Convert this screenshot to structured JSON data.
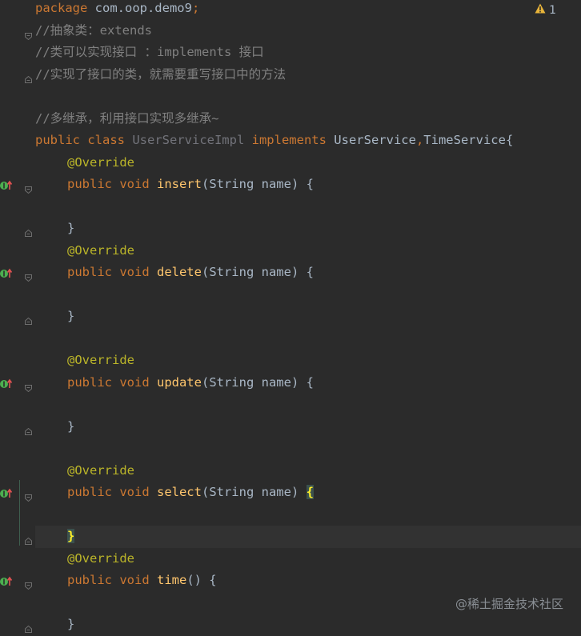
{
  "editor": {
    "lines": [
      [
        {
          "t": "kw",
          "v": "package "
        },
        {
          "t": "pkg",
          "v": "com.oop.demo9"
        },
        {
          "t": "kw",
          "v": ";"
        }
      ],
      [
        {
          "t": "cm",
          "v": "//抽象类：extends"
        }
      ],
      [
        {
          "t": "cm",
          "v": "//类可以实现接口 ：implements 接口"
        }
      ],
      [
        {
          "t": "cm",
          "v": "//实现了接口的类，就需要重写接口中的方法"
        }
      ],
      [],
      [
        {
          "t": "cm",
          "v": "//多继承，利用接口实现多继承~"
        }
      ],
      [
        {
          "t": "kw",
          "v": "public class "
        },
        {
          "t": "cls-unused",
          "v": "UserServiceImpl "
        },
        {
          "t": "kw",
          "v": "implements "
        },
        {
          "t": "plain",
          "v": "UserService"
        },
        {
          "t": "kw",
          "v": ","
        },
        {
          "t": "plain",
          "v": "TimeService{"
        }
      ],
      [
        {
          "t": "indent"
        },
        {
          "t": "ann",
          "v": "@Override"
        }
      ],
      [
        {
          "t": "indent"
        },
        {
          "t": "kw",
          "v": "public void "
        },
        {
          "t": "fn",
          "v": "insert"
        },
        {
          "t": "plain",
          "v": "(String name) {"
        }
      ],
      [],
      [
        {
          "t": "indent"
        },
        {
          "t": "plain",
          "v": "}"
        }
      ],
      [
        {
          "t": "indent"
        },
        {
          "t": "ann",
          "v": "@Override"
        }
      ],
      [
        {
          "t": "indent"
        },
        {
          "t": "kw",
          "v": "public void "
        },
        {
          "t": "fn",
          "v": "delete"
        },
        {
          "t": "plain",
          "v": "(String name) {"
        }
      ],
      [],
      [
        {
          "t": "indent"
        },
        {
          "t": "plain",
          "v": "}"
        }
      ],
      [],
      [
        {
          "t": "indent"
        },
        {
          "t": "ann",
          "v": "@Override"
        }
      ],
      [
        {
          "t": "indent"
        },
        {
          "t": "kw",
          "v": "public void "
        },
        {
          "t": "fn",
          "v": "update"
        },
        {
          "t": "plain",
          "v": "(String name) {"
        }
      ],
      [],
      [
        {
          "t": "indent"
        },
        {
          "t": "plain",
          "v": "}"
        }
      ],
      [],
      [
        {
          "t": "indent"
        },
        {
          "t": "ann",
          "v": "@Override"
        }
      ],
      [
        {
          "t": "indent"
        },
        {
          "t": "kw",
          "v": "public void "
        },
        {
          "t": "fn",
          "v": "select"
        },
        {
          "t": "plain",
          "v": "(String name) "
        },
        {
          "t": "brace-hl",
          "v": "{"
        }
      ],
      [],
      [
        {
          "t": "indent"
        },
        {
          "t": "brace-hl",
          "v": "}"
        }
      ],
      [
        {
          "t": "indent"
        },
        {
          "t": "ann",
          "v": "@Override"
        }
      ],
      [
        {
          "t": "indent"
        },
        {
          "t": "kw",
          "v": "public void "
        },
        {
          "t": "fn",
          "v": "time"
        },
        {
          "t": "plain",
          "v": "() {"
        }
      ],
      [],
      [
        {
          "t": "indent"
        },
        {
          "t": "plain",
          "v": "}"
        }
      ]
    ],
    "current_line_index": 24,
    "warning_count": "1",
    "warning_icon": "warning-triangle-icon",
    "implements_lines": [
      8,
      12,
      17,
      22,
      26
    ],
    "fold_open_lines": [
      1,
      8,
      12,
      17,
      22,
      26
    ],
    "fold_close_lines": [
      3,
      10,
      14,
      19,
      24,
      28
    ],
    "colors": {
      "background": "#2b2b2b",
      "keyword": "#cc7832",
      "comment": "#808080",
      "annotation": "#bbb529",
      "method": "#ffc66d",
      "text": "#a9b7c6",
      "warning": "#e8b43a",
      "implements_marker": "#4caf50",
      "arrow": "#e05252"
    }
  },
  "watermark": "@稀土掘金技术社区"
}
